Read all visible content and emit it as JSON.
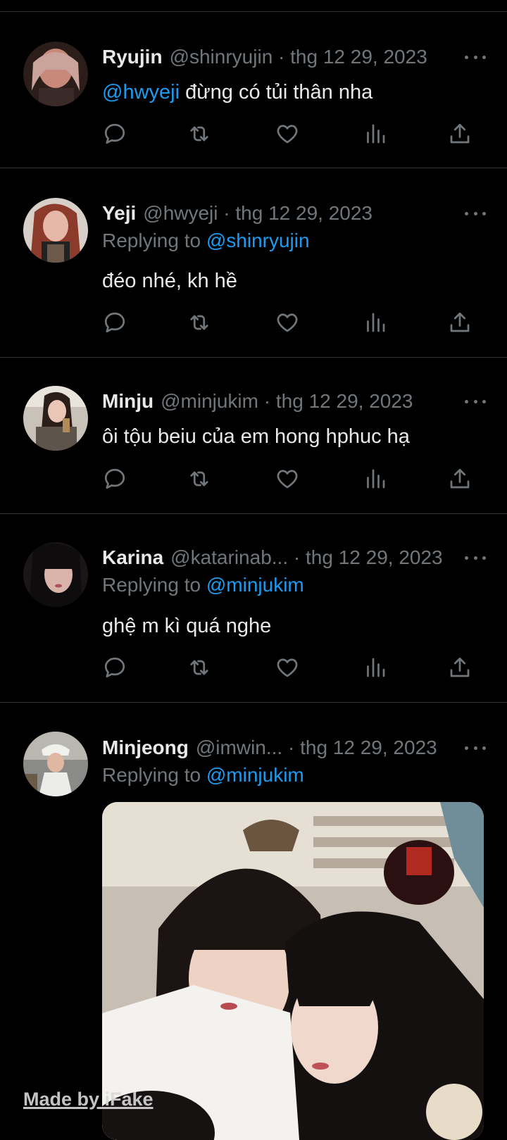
{
  "tweets": [
    {
      "name": "Ryujin",
      "handle": "@shinryujin",
      "date": "· thg 12 29, 2023",
      "mention": "@hwyeji",
      "text": " đừng có tủi thân nha"
    },
    {
      "name": "Yeji",
      "handle": "@hwyeji",
      "date": "· thg 12 29, 2023",
      "reply_label": "Replying to ",
      "reply_to": "@shinryujin",
      "text": "đéo nhé, kh hề"
    },
    {
      "name": "Minju",
      "handle": "@minjukim",
      "date": "· thg 12 29, 2023",
      "text": "ôi tộu beiu của em hong hphuc hạ"
    },
    {
      "name": "Karina",
      "handle": "@katarinab...",
      "date": "· thg 12 29, 2023",
      "reply_label": "Replying to ",
      "reply_to": "@minjukim",
      "text": "ghệ m kì quá nghe"
    },
    {
      "name": "Minjeong",
      "handle": "@imwin...",
      "date": "· thg 12 29, 2023",
      "reply_label": "Replying to ",
      "reply_to": "@minjukim"
    }
  ],
  "icons": [
    "reply-icon",
    "retweet-icon",
    "like-icon",
    "views-icon",
    "share-icon",
    "more-icon"
  ],
  "colors": {
    "background": "#000000",
    "text": "#e7e9ea",
    "muted": "#71767b",
    "link": "#1d9bf0",
    "divider": "#2f3336"
  },
  "watermark": "Made by iFake"
}
